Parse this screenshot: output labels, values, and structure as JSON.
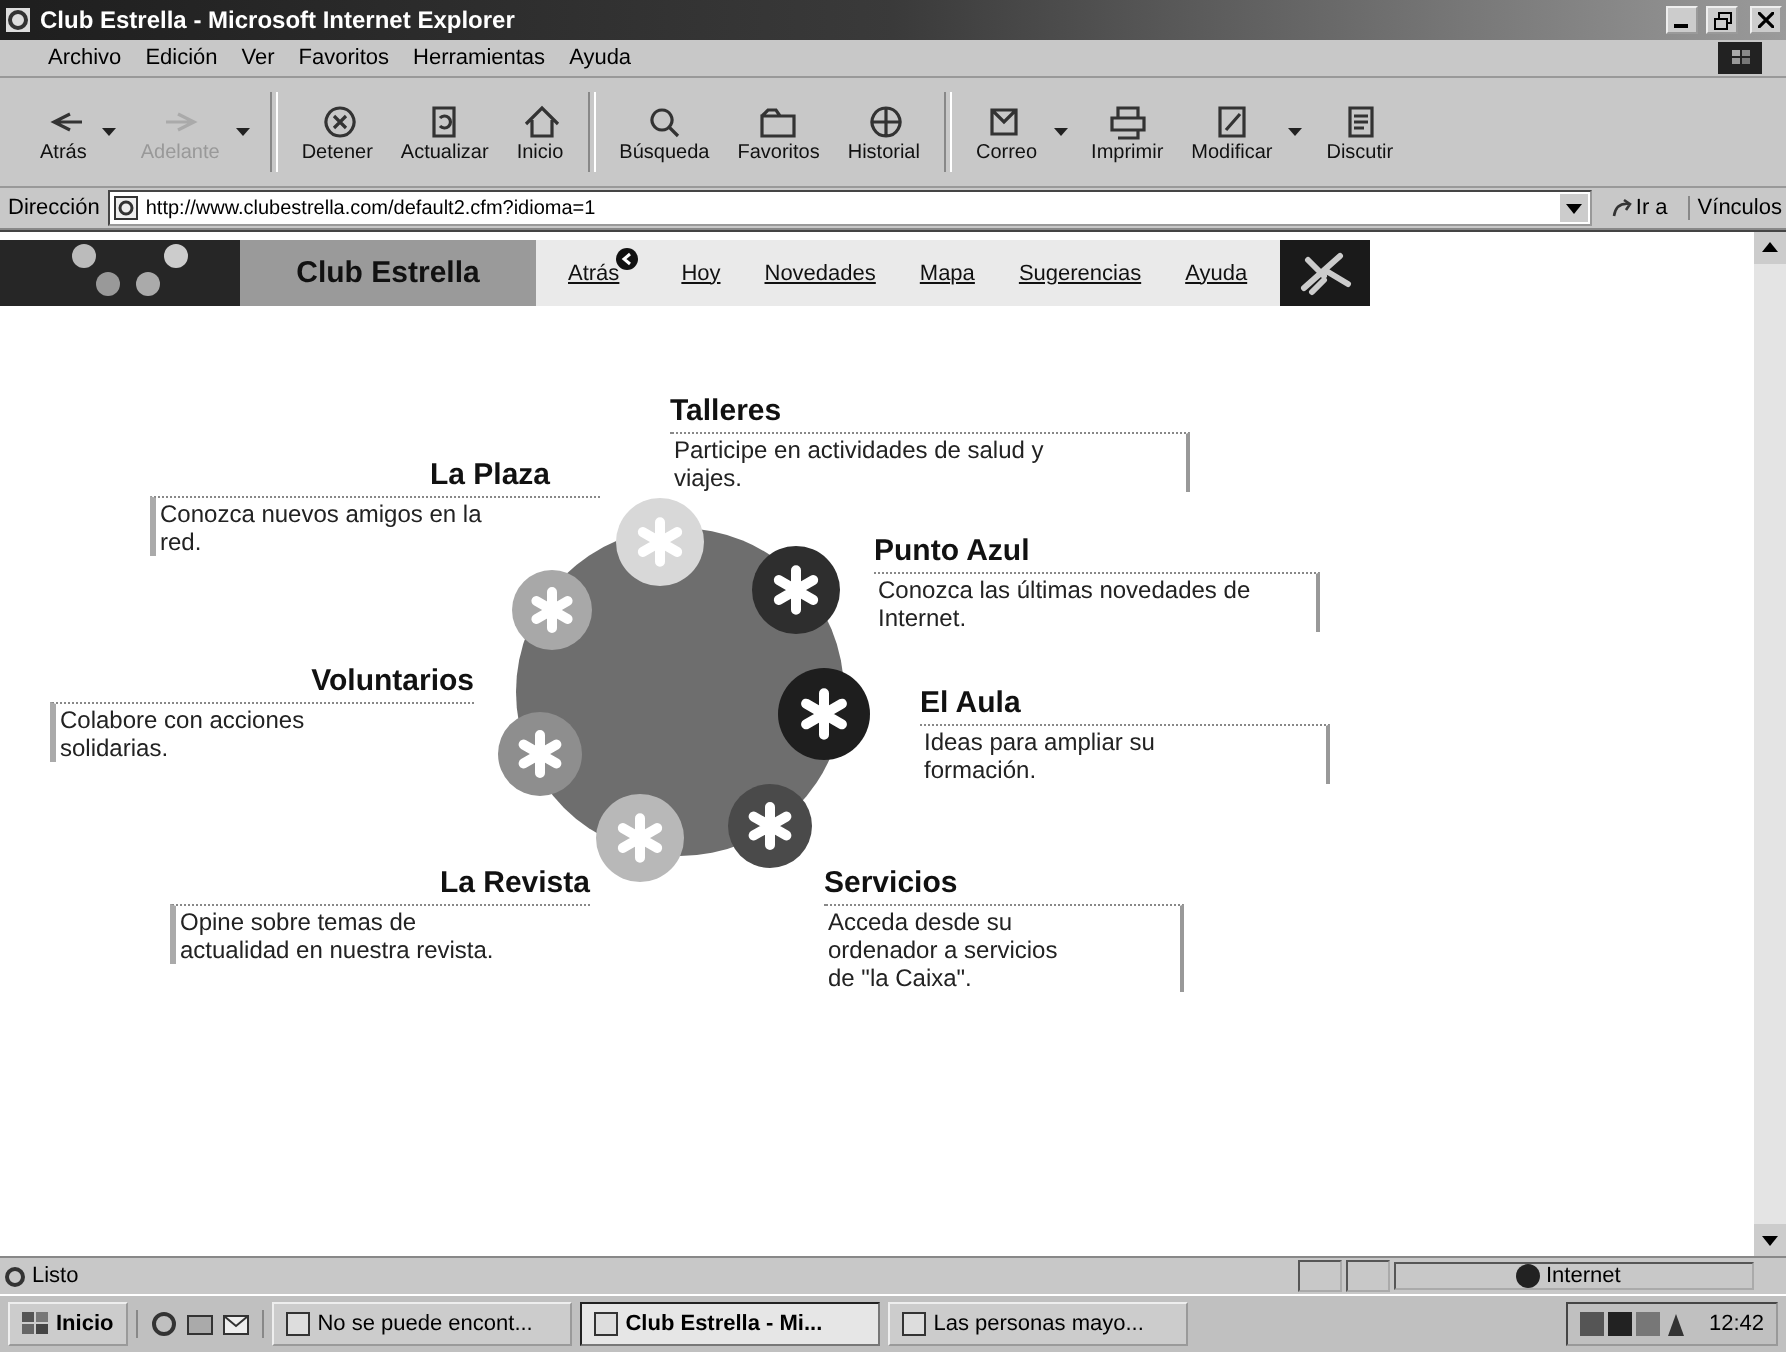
{
  "window": {
    "title": "Club Estrella - Microsoft Internet Explorer"
  },
  "menu": [
    "Archivo",
    "Edición",
    "Ver",
    "Favoritos",
    "Herramientas",
    "Ayuda"
  ],
  "toolbar": [
    {
      "label": "Atrás",
      "disabled": false,
      "dropdown": true
    },
    {
      "label": "Adelante",
      "disabled": true,
      "dropdown": true
    },
    {
      "label": "Detener",
      "disabled": false,
      "dropdown": false
    },
    {
      "label": "Actualizar",
      "disabled": false,
      "dropdown": false
    },
    {
      "label": "Inicio",
      "disabled": false,
      "dropdown": false
    },
    {
      "label": "Búsqueda",
      "disabled": false,
      "dropdown": false
    },
    {
      "label": "Favoritos",
      "disabled": false,
      "dropdown": false
    },
    {
      "label": "Historial",
      "disabled": false,
      "dropdown": false
    },
    {
      "label": "Correo",
      "disabled": false,
      "dropdown": true
    },
    {
      "label": "Imprimir",
      "disabled": false,
      "dropdown": false
    },
    {
      "label": "Modificar",
      "disabled": false,
      "dropdown": true
    },
    {
      "label": "Discutir",
      "disabled": false,
      "dropdown": false
    }
  ],
  "address": {
    "label": "Dirección",
    "value": "http://www.clubestrella.com/default2.cfm?idioma=1",
    "go": "Ir a",
    "links": "Vínculos"
  },
  "site": {
    "title": "Club Estrella",
    "nav": [
      "Atrás",
      "Hoy",
      "Novedades",
      "Mapa",
      "Sugerencias",
      "Ayuda"
    ],
    "sections": [
      {
        "title": "Talleres",
        "text": "Participe en actividades de salud y viajes."
      },
      {
        "title": "La Plaza",
        "text": "Conozca nuevos amigos en la red."
      },
      {
        "title": "Punto  Azul",
        "text": "Conozca las últimas novedades de Internet."
      },
      {
        "title": "Voluntarios",
        "text": "Colabore con acciones solidarias."
      },
      {
        "title": "El Aula",
        "text": "Ideas para ampliar su formación."
      },
      {
        "title": "La Revista",
        "text": "Opine sobre temas de actualidad en nuestra revista."
      },
      {
        "title": "Servicios",
        "text": "Acceda desde su ordenador a servicios de \"la Caixa\"."
      }
    ]
  },
  "status_bar": {
    "text": "Listo",
    "zone": "Internet"
  },
  "taskbar": {
    "start": "Inicio",
    "tasks": [
      {
        "label": "No se puede encont...",
        "selected": false
      },
      {
        "label": "Club Estrella - Mi...",
        "selected": true
      },
      {
        "label": "Las personas mayo...",
        "selected": false
      }
    ],
    "clock": "12:42"
  }
}
